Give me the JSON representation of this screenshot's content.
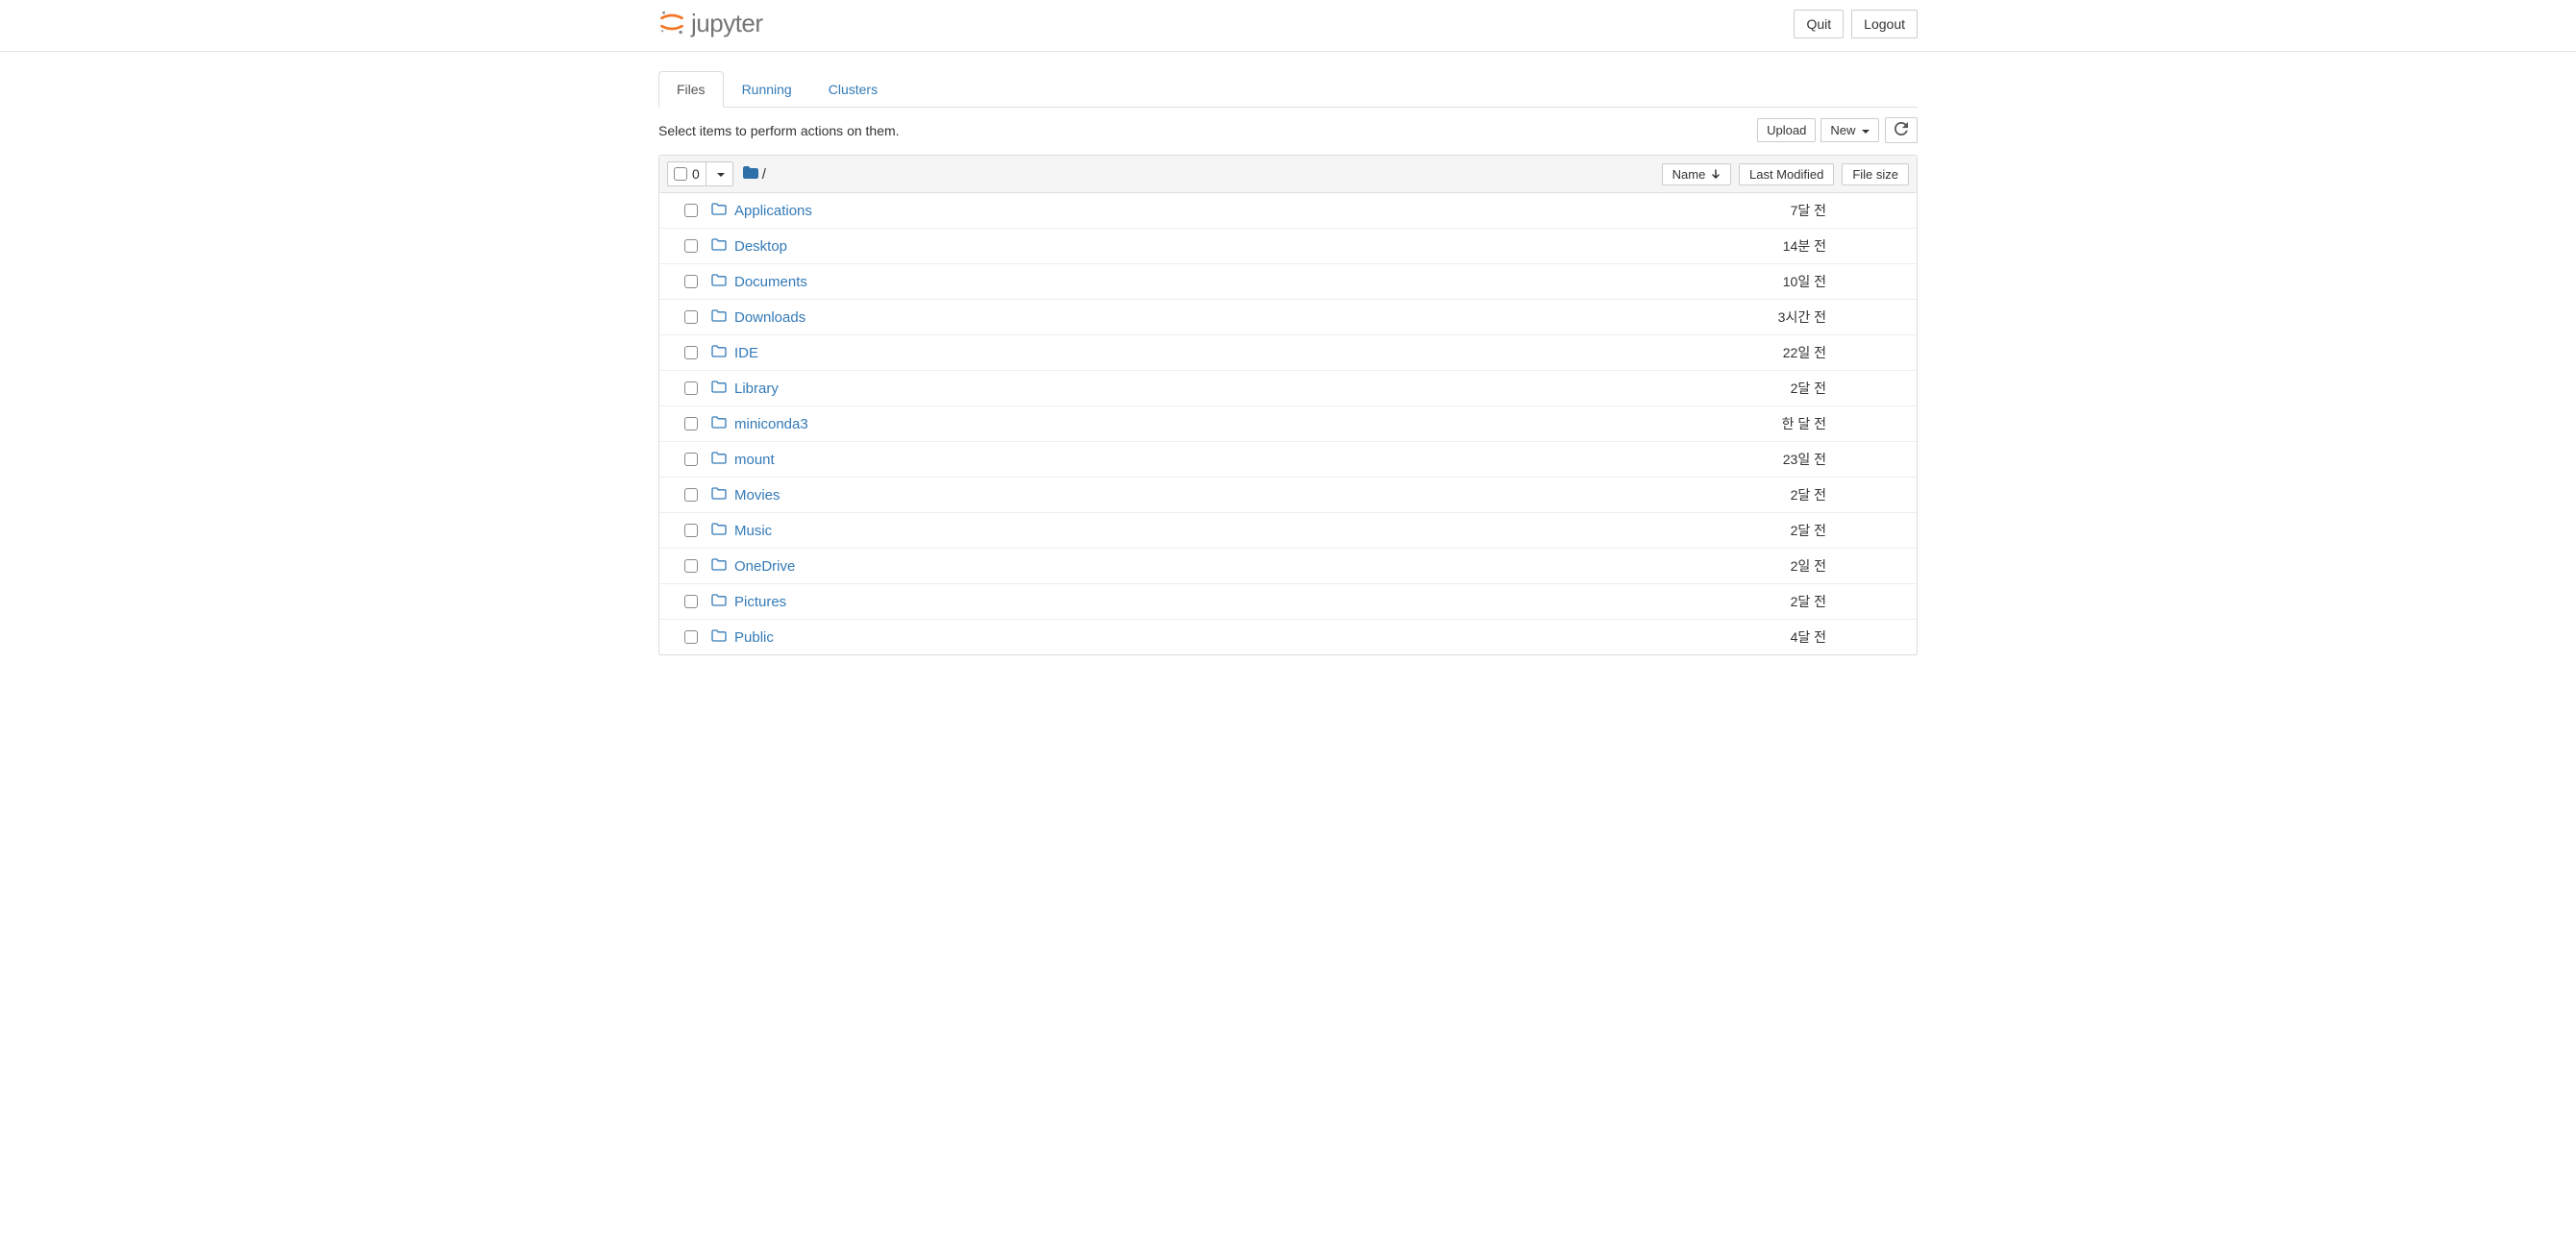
{
  "header": {
    "logo_text": "jupyter",
    "quit_label": "Quit",
    "logout_label": "Logout"
  },
  "tabs": [
    {
      "label": "Files",
      "active": true
    },
    {
      "label": "Running",
      "active": false
    },
    {
      "label": "Clusters",
      "active": false
    }
  ],
  "toolbar": {
    "hint": "Select items to perform actions on them.",
    "upload_label": "Upload",
    "new_label": "New"
  },
  "list_header": {
    "selected_count": "0",
    "breadcrumb_sep": "/",
    "name_col": "Name",
    "modified_col": "Last Modified",
    "size_col": "File size"
  },
  "files": [
    {
      "name": "Applications",
      "modified": "7달 전",
      "size": ""
    },
    {
      "name": "Desktop",
      "modified": "14분 전",
      "size": ""
    },
    {
      "name": "Documents",
      "modified": "10일 전",
      "size": ""
    },
    {
      "name": "Downloads",
      "modified": "3시간 전",
      "size": ""
    },
    {
      "name": "IDE",
      "modified": "22일 전",
      "size": ""
    },
    {
      "name": "Library",
      "modified": "2달 전",
      "size": ""
    },
    {
      "name": "miniconda3",
      "modified": "한 달 전",
      "size": ""
    },
    {
      "name": "mount",
      "modified": "23일 전",
      "size": ""
    },
    {
      "name": "Movies",
      "modified": "2달 전",
      "size": ""
    },
    {
      "name": "Music",
      "modified": "2달 전",
      "size": ""
    },
    {
      "name": "OneDrive",
      "modified": "2일 전",
      "size": ""
    },
    {
      "name": "Pictures",
      "modified": "2달 전",
      "size": ""
    },
    {
      "name": "Public",
      "modified": "4달 전",
      "size": ""
    }
  ]
}
